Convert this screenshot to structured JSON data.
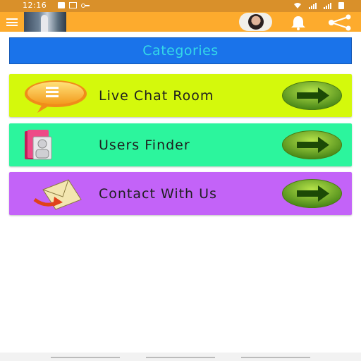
{
  "status_bar": {
    "time": "12:16",
    "left_icons": [
      "notification-square-icon",
      "image-icon",
      "key-icon"
    ],
    "right_icons": [
      "wifi-icon",
      "signal-icon",
      "signal-icon",
      "battery-icon"
    ]
  },
  "app_bar": {
    "icons": [
      "hamburger-menu-icon",
      "bell-icon",
      "share-icon"
    ],
    "color": "#fdab2d"
  },
  "header": {
    "title": "Categories",
    "bg_color": "#1a73ea",
    "text_color": "#34d9e8"
  },
  "menu": [
    {
      "label": "Live Chat Room",
      "icon": "chat-bubble-icon",
      "bg_color": "#d4f90c"
    },
    {
      "label": "Users Finder",
      "icon": "user-folder-icon",
      "bg_color": "#2cf59d"
    },
    {
      "label": "Contact With Us",
      "icon": "mail-envelope-icon",
      "bg_color": "#c363f8"
    }
  ]
}
